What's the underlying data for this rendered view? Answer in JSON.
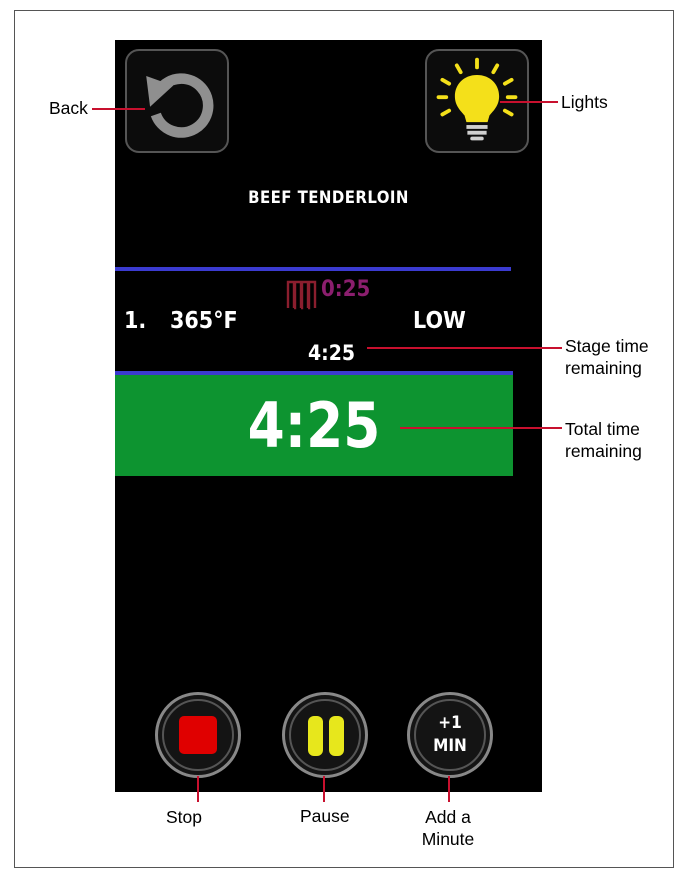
{
  "screen": {
    "dish_title": "BEEF TENDERLOIN",
    "stage": {
      "number": "1.",
      "temperature": "365°F",
      "fan_speed": "LOW",
      "stage_time_icon_label": "0:25",
      "stage_time_remaining": "4:25"
    },
    "total_time_remaining": "4:25",
    "add_minute_line1": "+1",
    "add_minute_line2": "MIN",
    "icons": {
      "back": "refresh-arrow-icon",
      "lights": "light-bulb-icon",
      "heat": "heating-element-icon",
      "stop": "stop-square-icon",
      "pause": "pause-bars-icon"
    },
    "colors": {
      "screen_bg": "#000000",
      "total_bar": "#0d9430",
      "divider": "#3b3bd0",
      "stop": "#e00000",
      "pause": "#e7e71c",
      "bulb": "#f4e01a",
      "stage_icon": "#8b1e6e"
    }
  },
  "callouts": {
    "back": "Back",
    "lights": "Lights",
    "stage_time_line1": "Stage time",
    "stage_time_line2": "remaining",
    "total_time_line1": "Total time",
    "total_time_line2": "remaining",
    "stop": "Stop",
    "pause": "Pause",
    "add_minute_line1": "Add a",
    "add_minute_line2": "Minute"
  }
}
